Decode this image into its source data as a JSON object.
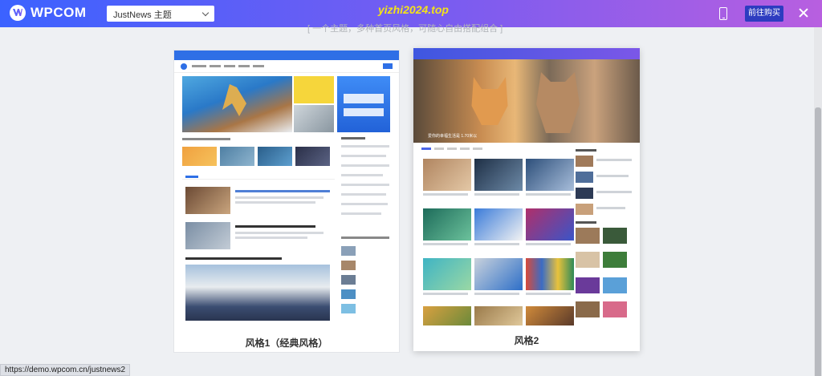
{
  "header": {
    "logo_text": "WPCOM",
    "theme_select_value": "JustNews 主题",
    "watermark": "yizhi2024.top",
    "buy_label": "前往购买"
  },
  "subtitle": "[  一个主题，多种首页风格，可随心自由搭配组合  ]",
  "previews": [
    {
      "label": "风格1（经典风格）"
    },
    {
      "label": "风格2"
    }
  ],
  "card2": {
    "hero_caption": "爱你的幸福生活是 1.70米以"
  },
  "status_url": "https://demo.wpcom.cn/justnews2",
  "icons": {
    "phone": "mobile-phone-icon",
    "close": "close-icon",
    "caret": "chevron-down-icon"
  },
  "colors": {
    "header_gradient_start": "#3b62ff",
    "header_gradient_end": "#b85fe0",
    "buy_button": "#2d3cc0",
    "watermark": "#f3e21a"
  }
}
